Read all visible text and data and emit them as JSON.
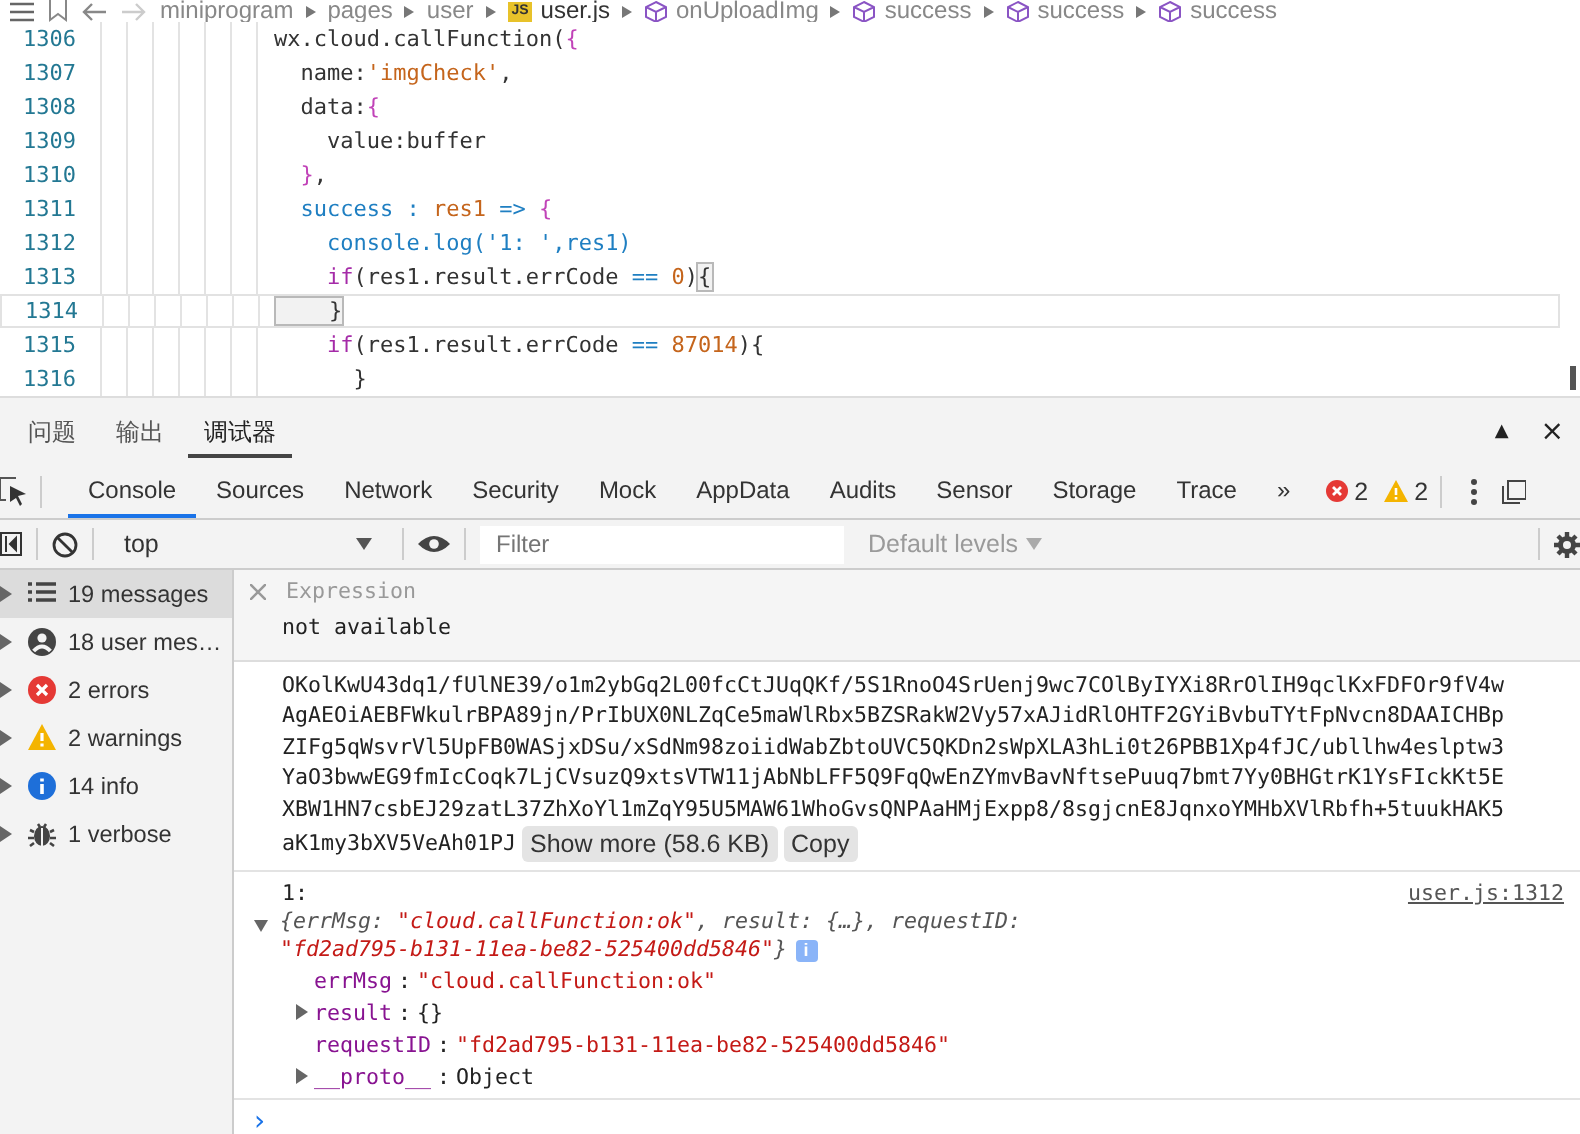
{
  "breadcrumb": [
    {
      "label": "miniprogram",
      "kind": "folder"
    },
    {
      "label": "pages",
      "kind": "folder"
    },
    {
      "label": "user",
      "kind": "folder"
    },
    {
      "label": "user.js",
      "kind": "file",
      "badge": "JS"
    },
    {
      "label": "onUploadImg",
      "kind": "symbol"
    },
    {
      "label": "success",
      "kind": "symbol"
    },
    {
      "label": "success",
      "kind": "symbol"
    },
    {
      "label": "success",
      "kind": "symbol"
    }
  ],
  "editor": {
    "lines": [
      {
        "number": "1306",
        "current": false,
        "tokens": [
          {
            "kind": "plain",
            "t": "wx.cloud.callFunction("
          },
          {
            "kind": "bracket",
            "t": "{"
          }
        ]
      },
      {
        "number": "1307",
        "current": false,
        "tokens": [
          {
            "kind": "plain",
            "t": "  name:"
          },
          {
            "kind": "string",
            "t": "'imgCheck'"
          },
          {
            "kind": "plain",
            "t": ","
          }
        ]
      },
      {
        "number": "1308",
        "current": false,
        "tokens": [
          {
            "kind": "plain",
            "t": "  data:"
          },
          {
            "kind": "bracket",
            "t": "{"
          }
        ]
      },
      {
        "number": "1309",
        "current": false,
        "tokens": [
          {
            "kind": "plain",
            "t": "    value:buffer"
          }
        ]
      },
      {
        "number": "1310",
        "current": false,
        "tokens": [
          {
            "kind": "bracket",
            "t": "  }"
          },
          {
            "kind": "plain",
            "t": ","
          }
        ]
      },
      {
        "number": "1311",
        "current": false,
        "tokens": [
          {
            "kind": "keyword",
            "t": "  success : "
          },
          {
            "kind": "string",
            "t": "res1"
          },
          {
            "kind": "keyword",
            "t": " => "
          },
          {
            "kind": "bracket",
            "t": "{"
          }
        ]
      },
      {
        "number": "1312",
        "current": false,
        "tokens": [
          {
            "kind": "keyword",
            "t": "    console.log('1: ',res1)"
          }
        ]
      },
      {
        "number": "1313",
        "current": false,
        "tokens": [
          {
            "kind": "control",
            "t": "    if"
          },
          {
            "kind": "plain",
            "t": "(res1.result.errCode "
          },
          {
            "kind": "keyword",
            "t": "=="
          },
          {
            "kind": "string",
            "t": " 0"
          },
          {
            "kind": "plain",
            "t": ")"
          },
          {
            "kind": "match",
            "t": "{"
          }
        ]
      },
      {
        "number": "1314",
        "current": true,
        "tokens": [
          {
            "kind": "match",
            "t": "    }"
          }
        ]
      },
      {
        "number": "1315",
        "current": false,
        "tokens": [
          {
            "kind": "control",
            "t": "    if"
          },
          {
            "kind": "plain",
            "t": "(res1.result.errCode "
          },
          {
            "kind": "keyword",
            "t": "=="
          },
          {
            "kind": "string",
            "t": " 87014"
          },
          {
            "kind": "plain",
            "t": "){"
          }
        ]
      },
      {
        "number": "1316",
        "current": false,
        "tokens": [
          {
            "kind": "plain",
            "t": "      }"
          }
        ]
      }
    ]
  },
  "panel_tabs": [
    {
      "label": "问题",
      "selected": false
    },
    {
      "label": "输出",
      "selected": false
    },
    {
      "label": "调试器",
      "selected": true
    }
  ],
  "panel_controls": [
    "▲",
    "×"
  ],
  "devtools_tabs": [
    {
      "label": "Console",
      "selected": true
    },
    {
      "label": "Sources",
      "selected": false
    },
    {
      "label": "Network",
      "selected": false
    },
    {
      "label": "Security",
      "selected": false
    },
    {
      "label": "Mock",
      "selected": false
    },
    {
      "label": "AppData",
      "selected": false
    },
    {
      "label": "Audits",
      "selected": false
    },
    {
      "label": "Sensor",
      "selected": false
    },
    {
      "label": "Storage",
      "selected": false
    },
    {
      "label": "Trace",
      "selected": false
    }
  ],
  "more_tabs": "»",
  "error_count": "2",
  "warning_count": "2",
  "toolbar": {
    "context": "top",
    "filter_placeholder": "Filter",
    "levels": "Default levels"
  },
  "sidebar": [
    {
      "label": "19 messages",
      "kind": "list",
      "selected": true
    },
    {
      "label": "18 user mes…",
      "kind": "user",
      "selected": false
    },
    {
      "label": "2 errors",
      "kind": "error",
      "selected": false
    },
    {
      "label": "2 warnings",
      "kind": "warning",
      "selected": false
    },
    {
      "label": "14 info",
      "kind": "info",
      "selected": false
    },
    {
      "label": "1 verbose",
      "kind": "verbose",
      "selected": false
    }
  ],
  "expression": {
    "label": "Expression",
    "value": "not available"
  },
  "blob": {
    "lines": [
      "OKolKwU43dq1/fUlNE39/o1m2ybGq2L00fcCtJUqQKf/5S1RnoO4SrUenj9wc7COlByIYXi8RrOlIH9qclKxFDFOr9fV4w",
      "AgAEOiAEBFWkulrBPA89jn/PrIbUX0NLZqCe5maWlRbx5BZSRakW2Vy57xAJidRlOHTF2GYiBvbuTYtFpNvcn8DAAICHBp",
      "ZIFg5qWsvrVl5UpFB0WASjxDSu/xSdNm98zoiidWabZbtoUVC5QKDn2sWpXLA3hLi0t26PBB1Xp4fJC/ubllhw4eslptw3",
      "YaO3bwwEG9fmIcCoqk7LjCVsuzQ9xtsVTW11jAbNbLFF5Q9FqQwEnZYmvBavNftsePuuq7bmt7Yy0BHGtrK1YsFIckKt5E",
      "XBW1HN7csbEJ29zatL37ZhXoYl1mZqY95U5MAW61WhoGvsQNPAaHMjExpp8/8sgjcnE8JqnxoYMHbXVlRbfh+5tuukHAK5",
      "aK1my3bXV5VeAh01PJ"
    ],
    "show_more": "Show more (58.6 KB)",
    "copy": "Copy"
  },
  "log": {
    "label": "1:",
    "source": "user.js:1312",
    "expanded": true,
    "preview": [
      {
        "kind": "key",
        "t": "{errMsg: "
      },
      {
        "kind": "str",
        "t": "\"cloud.callFunction:ok\""
      },
      {
        "kind": "key",
        "t": ", result: {…}, requestID: "
      },
      {
        "kind": "str",
        "t": "\"fd2ad795-b131-11ea-be82-525400dd5846\""
      },
      {
        "kind": "key",
        "t": "}"
      }
    ],
    "info_badge": "i",
    "properties": [
      {
        "key": "errMsg",
        "separator": ":",
        "value": "\"cloud.callFunction:ok\"",
        "kind": "string",
        "expandable": false
      },
      {
        "key": "result",
        "separator": ":",
        "value": "{}",
        "kind": "plain",
        "expandable": true
      },
      {
        "key": "requestID",
        "separator": ":",
        "value": "\"fd2ad795-b131-11ea-be82-525400dd5846\"",
        "kind": "string",
        "expandable": false
      },
      {
        "key": "__proto__",
        "separator": ":",
        "value": "Object",
        "kind": "plain",
        "expandable": true
      }
    ]
  },
  "prompt": "›"
}
